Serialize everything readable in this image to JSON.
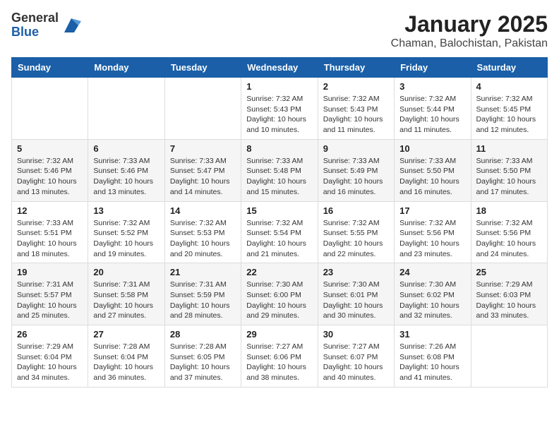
{
  "header": {
    "logo": {
      "general": "General",
      "blue": "Blue"
    },
    "title": "January 2025",
    "subtitle": "Chaman, Balochistan, Pakistan"
  },
  "weekdays": [
    "Sunday",
    "Monday",
    "Tuesday",
    "Wednesday",
    "Thursday",
    "Friday",
    "Saturday"
  ],
  "weeks": [
    [
      {
        "day": "",
        "info": ""
      },
      {
        "day": "",
        "info": ""
      },
      {
        "day": "",
        "info": ""
      },
      {
        "day": "1",
        "info": "Sunrise: 7:32 AM\nSunset: 5:43 PM\nDaylight: 10 hours\nand 10 minutes."
      },
      {
        "day": "2",
        "info": "Sunrise: 7:32 AM\nSunset: 5:43 PM\nDaylight: 10 hours\nand 11 minutes."
      },
      {
        "day": "3",
        "info": "Sunrise: 7:32 AM\nSunset: 5:44 PM\nDaylight: 10 hours\nand 11 minutes."
      },
      {
        "day": "4",
        "info": "Sunrise: 7:32 AM\nSunset: 5:45 PM\nDaylight: 10 hours\nand 12 minutes."
      }
    ],
    [
      {
        "day": "5",
        "info": "Sunrise: 7:32 AM\nSunset: 5:46 PM\nDaylight: 10 hours\nand 13 minutes."
      },
      {
        "day": "6",
        "info": "Sunrise: 7:33 AM\nSunset: 5:46 PM\nDaylight: 10 hours\nand 13 minutes."
      },
      {
        "day": "7",
        "info": "Sunrise: 7:33 AM\nSunset: 5:47 PM\nDaylight: 10 hours\nand 14 minutes."
      },
      {
        "day": "8",
        "info": "Sunrise: 7:33 AM\nSunset: 5:48 PM\nDaylight: 10 hours\nand 15 minutes."
      },
      {
        "day": "9",
        "info": "Sunrise: 7:33 AM\nSunset: 5:49 PM\nDaylight: 10 hours\nand 16 minutes."
      },
      {
        "day": "10",
        "info": "Sunrise: 7:33 AM\nSunset: 5:50 PM\nDaylight: 10 hours\nand 16 minutes."
      },
      {
        "day": "11",
        "info": "Sunrise: 7:33 AM\nSunset: 5:50 PM\nDaylight: 10 hours\nand 17 minutes."
      }
    ],
    [
      {
        "day": "12",
        "info": "Sunrise: 7:33 AM\nSunset: 5:51 PM\nDaylight: 10 hours\nand 18 minutes."
      },
      {
        "day": "13",
        "info": "Sunrise: 7:32 AM\nSunset: 5:52 PM\nDaylight: 10 hours\nand 19 minutes."
      },
      {
        "day": "14",
        "info": "Sunrise: 7:32 AM\nSunset: 5:53 PM\nDaylight: 10 hours\nand 20 minutes."
      },
      {
        "day": "15",
        "info": "Sunrise: 7:32 AM\nSunset: 5:54 PM\nDaylight: 10 hours\nand 21 minutes."
      },
      {
        "day": "16",
        "info": "Sunrise: 7:32 AM\nSunset: 5:55 PM\nDaylight: 10 hours\nand 22 minutes."
      },
      {
        "day": "17",
        "info": "Sunrise: 7:32 AM\nSunset: 5:56 PM\nDaylight: 10 hours\nand 23 minutes."
      },
      {
        "day": "18",
        "info": "Sunrise: 7:32 AM\nSunset: 5:56 PM\nDaylight: 10 hours\nand 24 minutes."
      }
    ],
    [
      {
        "day": "19",
        "info": "Sunrise: 7:31 AM\nSunset: 5:57 PM\nDaylight: 10 hours\nand 25 minutes."
      },
      {
        "day": "20",
        "info": "Sunrise: 7:31 AM\nSunset: 5:58 PM\nDaylight: 10 hours\nand 27 minutes."
      },
      {
        "day": "21",
        "info": "Sunrise: 7:31 AM\nSunset: 5:59 PM\nDaylight: 10 hours\nand 28 minutes."
      },
      {
        "day": "22",
        "info": "Sunrise: 7:30 AM\nSunset: 6:00 PM\nDaylight: 10 hours\nand 29 minutes."
      },
      {
        "day": "23",
        "info": "Sunrise: 7:30 AM\nSunset: 6:01 PM\nDaylight: 10 hours\nand 30 minutes."
      },
      {
        "day": "24",
        "info": "Sunrise: 7:30 AM\nSunset: 6:02 PM\nDaylight: 10 hours\nand 32 minutes."
      },
      {
        "day": "25",
        "info": "Sunrise: 7:29 AM\nSunset: 6:03 PM\nDaylight: 10 hours\nand 33 minutes."
      }
    ],
    [
      {
        "day": "26",
        "info": "Sunrise: 7:29 AM\nSunset: 6:04 PM\nDaylight: 10 hours\nand 34 minutes."
      },
      {
        "day": "27",
        "info": "Sunrise: 7:28 AM\nSunset: 6:04 PM\nDaylight: 10 hours\nand 36 minutes."
      },
      {
        "day": "28",
        "info": "Sunrise: 7:28 AM\nSunset: 6:05 PM\nDaylight: 10 hours\nand 37 minutes."
      },
      {
        "day": "29",
        "info": "Sunrise: 7:27 AM\nSunset: 6:06 PM\nDaylight: 10 hours\nand 38 minutes."
      },
      {
        "day": "30",
        "info": "Sunrise: 7:27 AM\nSunset: 6:07 PM\nDaylight: 10 hours\nand 40 minutes."
      },
      {
        "day": "31",
        "info": "Sunrise: 7:26 AM\nSunset: 6:08 PM\nDaylight: 10 hours\nand 41 minutes."
      },
      {
        "day": "",
        "info": ""
      }
    ]
  ]
}
